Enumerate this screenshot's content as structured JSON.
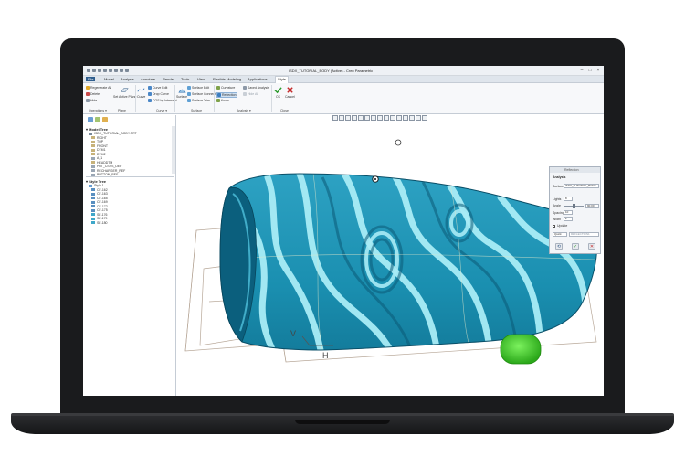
{
  "window": {
    "title": "ISDX_TUTORIAL_BODY (Active) - Creo Parametric"
  },
  "tabs": [
    {
      "label": "File"
    },
    {
      "label": "Model"
    },
    {
      "label": "Analysis"
    },
    {
      "label": "Annotate"
    },
    {
      "label": "Render"
    },
    {
      "label": "Tools"
    },
    {
      "label": "View"
    },
    {
      "label": "Flexible Modeling"
    },
    {
      "label": "Applications"
    },
    {
      "label": "Style"
    }
  ],
  "ribbon": {
    "regenerate": "Regenerate All",
    "delete": "Delete",
    "hide": "Hide",
    "set_active_plane": "Set Active Plane",
    "curve": "Curve",
    "curve_edit": "Curve Edit",
    "drop_curve": "Drop Curve",
    "cos_by_intersect": "COS by Intersect",
    "surface": "Surface",
    "surface_edit": "Surface Edit",
    "surface_connect": "Surface Connect",
    "surface_trim": "Surface Trim",
    "curvature": "Curvature",
    "reflection": "Reflection",
    "knots": "Knots",
    "saved_analysis": "Saved Analysis",
    "hide_all": "Hide All",
    "ok": "OK",
    "cancel": "Cancel",
    "groups": {
      "operations": "Operations ▾",
      "plane": "Plane",
      "curve": "Curve ▾",
      "surface": "Surface",
      "analysis": "Analysis ▾",
      "close": "Close"
    }
  },
  "model_tree": {
    "header": "Model Tree",
    "items": [
      "ISDX_TUTORIAL_BODY.PRT",
      "RIGHT",
      "TOP",
      "FRONT",
      "DTM1",
      "DTM2",
      "A_1",
      "HEADDTM",
      "PRT_CSYS_DEF",
      "RECHARGER_REF",
      "BUTTON_REF"
    ]
  },
  "style_tree": {
    "header": "Style Tree",
    "items": [
      "Style 1",
      "CF-162",
      "CF-163",
      "CF-165",
      "CF-169",
      "CF-172",
      "CF-175",
      "SF-176",
      "SF-179",
      "SF-180"
    ]
  },
  "reflection_dialog": {
    "title": "Reflection",
    "section": "Analysis",
    "surface_label": "Surface",
    "surface_value": "ISDX_TUTORIAL_BODY",
    "lights_label": "Lights",
    "lights_value": "8",
    "angle_label": "Angle",
    "angle_value": "90.00",
    "spacing_label": "Spacing",
    "spacing_value": "10",
    "width_label": "Width",
    "width_value": "2",
    "update_label": "Update",
    "quick_label": "Quick",
    "quick_value": "REFLECTION1"
  },
  "viewport": {
    "triad_v": "V",
    "triad_h": "H"
  },
  "colors": {
    "surface": "#1a8fb0",
    "stripe": "#a9ecf6",
    "button": "#3fd32a",
    "ok_green": "#2c9a2c",
    "cancel_red": "#c42a2a"
  }
}
